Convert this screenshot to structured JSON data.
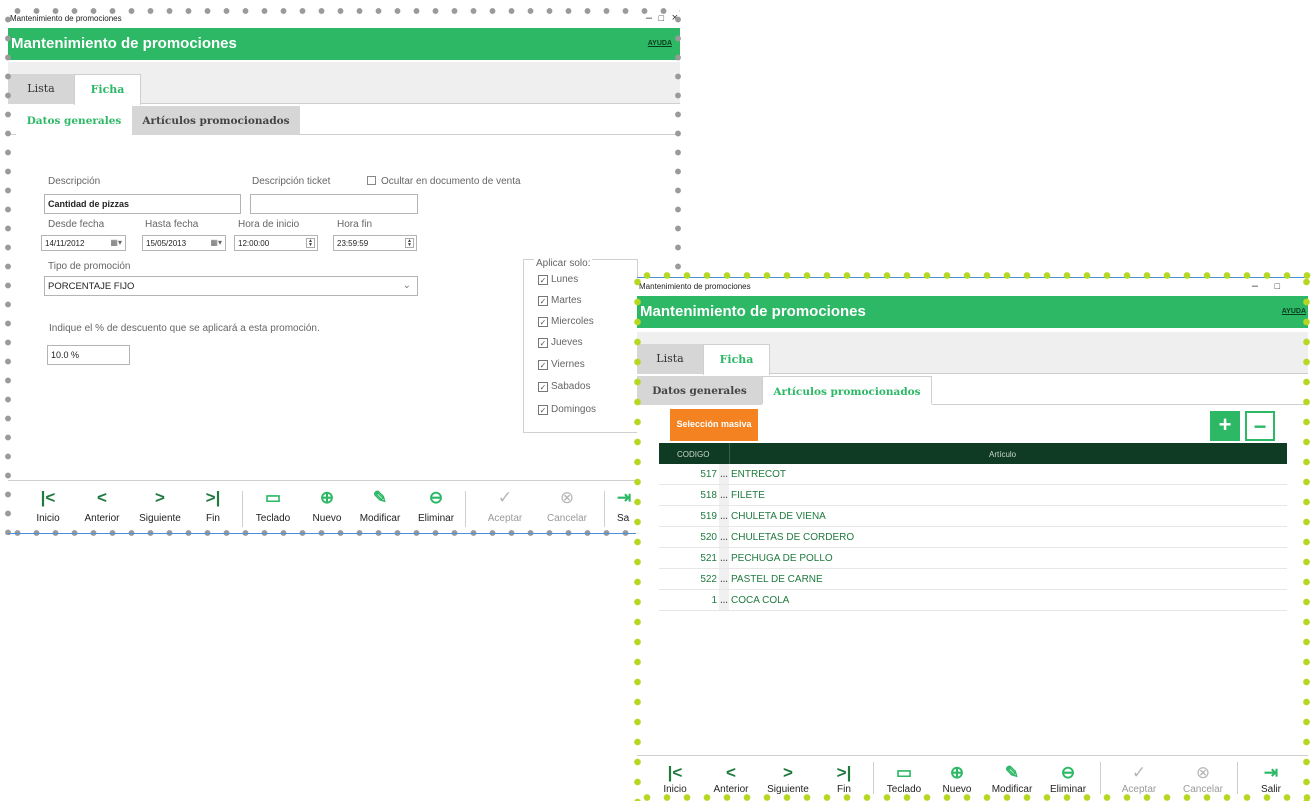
{
  "window1": {
    "title": "Mantenimiento de promociones",
    "header": "Mantenimiento de promociones",
    "help": "AYUDA",
    "tabs": [
      "Lista",
      "Ficha"
    ],
    "subtabs": [
      "Datos generales",
      "Artículos promocionados"
    ],
    "form": {
      "descripcion_label": "Descripción",
      "descripcion_value": "Cantidad de pizzas",
      "ticket_label": "Descripción ticket",
      "ticket_value": "",
      "ocultar_label": "Ocultar en documento de venta",
      "desde_label": "Desde fecha",
      "desde_value": "14/11/2012",
      "hasta_label": "Hasta fecha",
      "hasta_value": "15/05/2013",
      "hora_inicio_label": "Hora de inicio",
      "hora_inicio_value": "12:00:00",
      "hora_fin_label": "Hora fin",
      "hora_fin_value": "23:59:59",
      "tipo_label": "Tipo de promoción",
      "tipo_value": "PORCENTAJE FIJO",
      "indique_text": "Indique el % de descuento que se aplicará a esta promoción.",
      "porcentaje_value": "10.0 %",
      "aplicar_label": "Aplicar solo:",
      "days": [
        "Lunes",
        "Martes",
        "Miercoles",
        "Jueves",
        "Viernes",
        "Sabados",
        "Domingos"
      ]
    },
    "footer": [
      "Inicio",
      "Anterior",
      "Siguiente",
      "Fin",
      "Teclado",
      "Nuevo",
      "Modificar",
      "Eliminar",
      "Aceptar",
      "Cancelar",
      "Sa"
    ]
  },
  "window2": {
    "title": "Mantenimiento de promociones",
    "header": "Mantenimiento de promociones",
    "help": "AYUDA",
    "tabs": [
      "Lista",
      "Ficha"
    ],
    "subtabs": [
      "Datos generales",
      "Artículos promocionados"
    ],
    "seleccion_masiva": "Selección masiva",
    "plus": "+",
    "minus": "−",
    "columns": [
      "CODIGO",
      "Artículo"
    ],
    "rows": [
      {
        "code": "517",
        "name": "ENTRECOT"
      },
      {
        "code": "518",
        "name": "FILETE"
      },
      {
        "code": "519",
        "name": "CHULETA DE VIENA"
      },
      {
        "code": "520",
        "name": "CHULETAS DE CORDERO"
      },
      {
        "code": "521",
        "name": "PECHUGA DE POLLO"
      },
      {
        "code": "522",
        "name": "PASTEL DE CARNE"
      },
      {
        "code": "1",
        "name": "COCA COLA"
      }
    ],
    "footer": [
      "Inicio",
      "Anterior",
      "Siguiente",
      "Fin",
      "Teclado",
      "Nuevo",
      "Modificar",
      "Eliminar",
      "Aceptar",
      "Cancelar",
      "Salir"
    ]
  },
  "icons": {
    "inicio": "first-page-icon",
    "anterior": "chevron-left-icon",
    "siguiente": "chevron-right-icon",
    "fin": "last-page-icon",
    "teclado": "keyboard-icon",
    "nuevo": "plus-circle-icon",
    "modificar": "pencil-icon",
    "eliminar": "minus-circle-icon",
    "aceptar": "check-circle-icon",
    "cancelar": "x-circle-icon",
    "salir": "exit-icon"
  },
  "colors": {
    "accent": "#2db866",
    "grid_header": "#0f3a23",
    "orange": "#f58220",
    "selection_gray": "#9a9a9a",
    "selection_lime": "#b6d824"
  }
}
